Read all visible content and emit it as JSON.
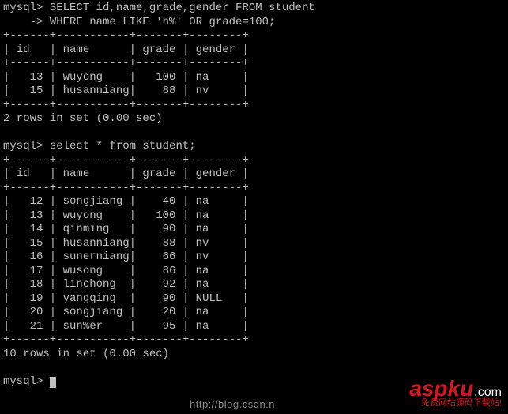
{
  "terminal": {
    "prompt": "mysql> ",
    "continuation": "    -> ",
    "query1_line1": "SELECT id,name,grade,gender FROM student",
    "query1_line2": "WHERE name LIKE 'h%' OR grade=100;",
    "table1": {
      "border_plus": "+------+-----------+-------+--------+",
      "header": "| id   | name      | grade | gender |",
      "rows": [
        "|   13 | wuyong    |   100 | na     |",
        "|   15 | husanniang|    88 | nv     |"
      ]
    },
    "result1_summary": "2 rows in set (0.00 sec)",
    "query2": "select * from student;",
    "table2": {
      "border_plus": "+------+-----------+-------+--------+",
      "header": "| id   | name      | grade | gender |",
      "rows": [
        "|   12 | songjiang |    40 | na     |",
        "|   13 | wuyong    |   100 | na     |",
        "|   14 | qinming   |    90 | na     |",
        "|   15 | husanniang|    88 | nv     |",
        "|   16 | sunerniang|    66 | nv     |",
        "|   17 | wusong    |    86 | na     |",
        "|   18 | linchong  |    92 | na     |",
        "|   19 | yangqing  |    90 | NULL   |",
        "|   20 | songjiang |    20 | na     |",
        "|   21 | sun%er    |    95 | na     |"
      ]
    },
    "result2_summary": "10 rows in set (0.00 sec)"
  },
  "footer": {
    "url_fragment": "http://blog.csdn.n",
    "watermark_brand_red": "aspku",
    "watermark_brand_dot": ".",
    "watermark_brand_com": "com",
    "watermark_tag": "免费网站源码下载站!"
  },
  "chart_data": {
    "type": "table",
    "tables": [
      {
        "title": "SELECT id,name,grade,gender FROM student WHERE name LIKE 'h%' OR grade=100",
        "columns": [
          "id",
          "name",
          "grade",
          "gender"
        ],
        "rows": [
          [
            13,
            "wuyong",
            100,
            "na"
          ],
          [
            15,
            "husanniang",
            88,
            "nv"
          ]
        ]
      },
      {
        "title": "select * from student",
        "columns": [
          "id",
          "name",
          "grade",
          "gender"
        ],
        "rows": [
          [
            12,
            "songjiang",
            40,
            "na"
          ],
          [
            13,
            "wuyong",
            100,
            "na"
          ],
          [
            14,
            "qinming",
            90,
            "na"
          ],
          [
            15,
            "husanniang",
            88,
            "nv"
          ],
          [
            16,
            "sunerniang",
            66,
            "nv"
          ],
          [
            17,
            "wusong",
            86,
            "na"
          ],
          [
            18,
            "linchong",
            92,
            "na"
          ],
          [
            19,
            "yangqing",
            90,
            null
          ],
          [
            20,
            "songjiang",
            20,
            "na"
          ],
          [
            21,
            "sun%er",
            95,
            "na"
          ]
        ]
      }
    ]
  }
}
